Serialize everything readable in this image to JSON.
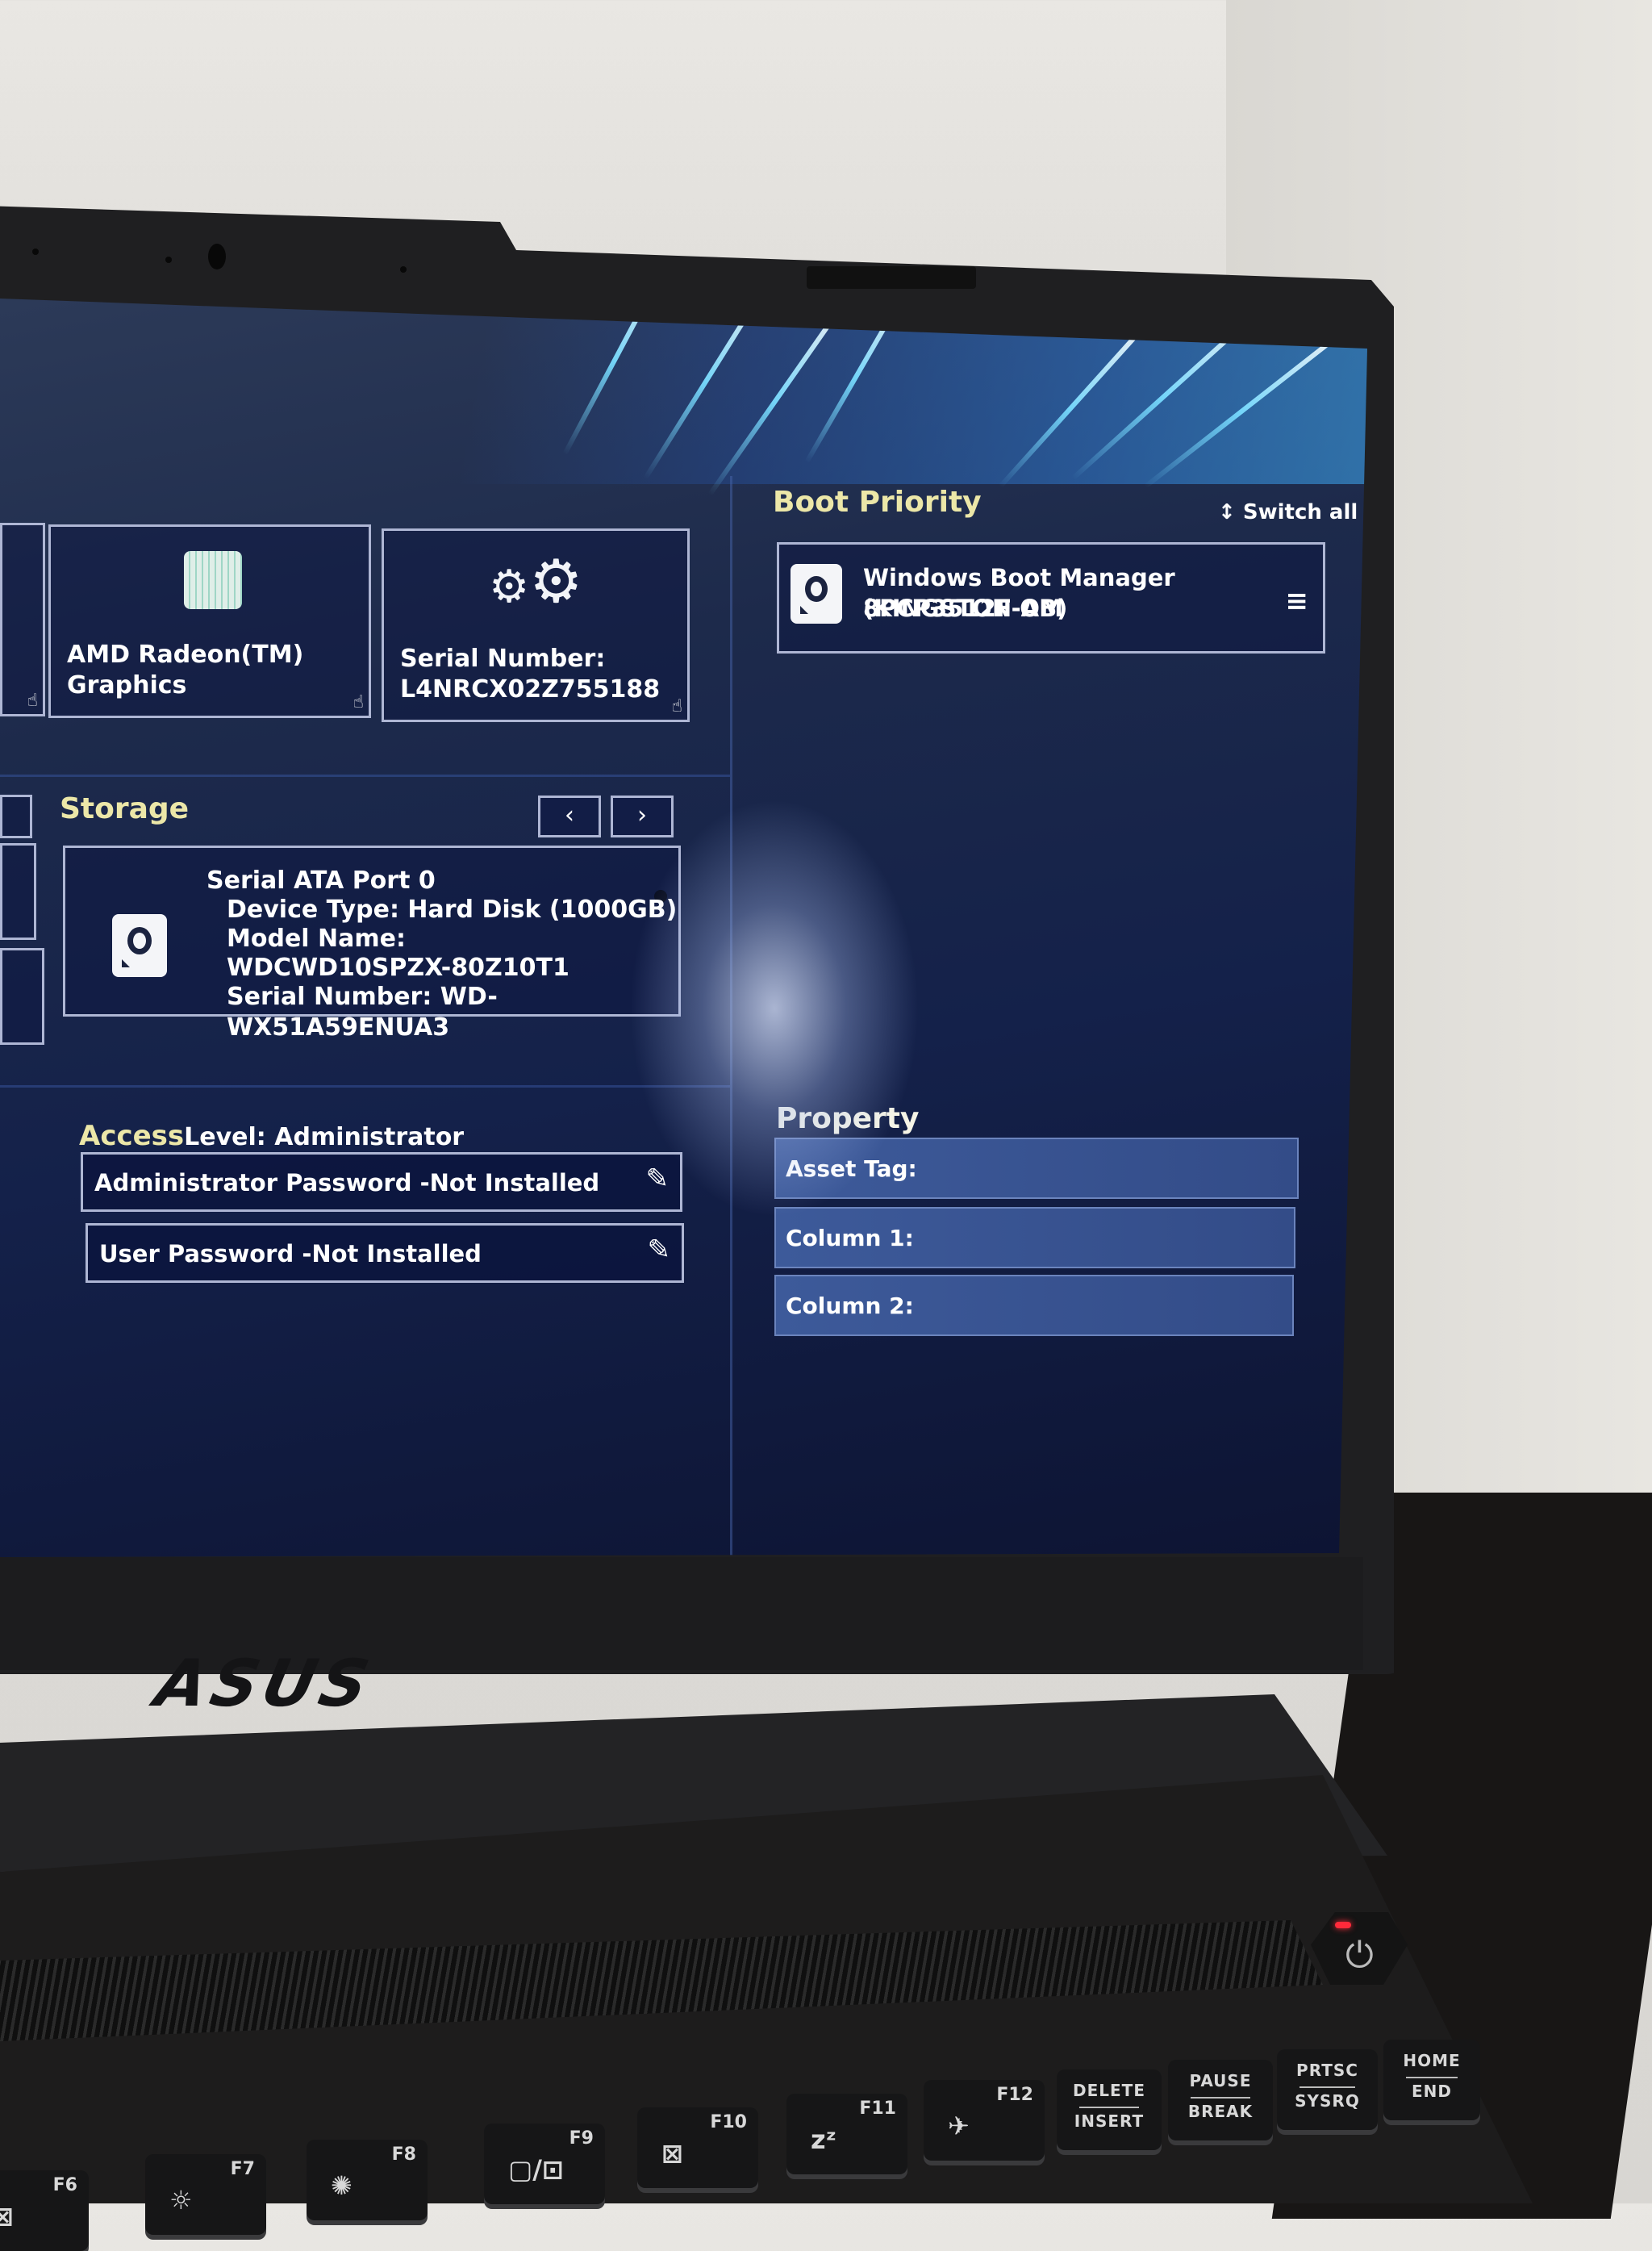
{
  "device": {
    "brand_logo": "ASUS",
    "power_led_color": "#ff2a3a"
  },
  "bios": {
    "accent_color": "#ece7a8",
    "overview_cards": [
      {
        "icon": "gpu-chip-icon",
        "line1": "AMD Radeon(TM)",
        "line2": "Graphics"
      },
      {
        "icon": "gears-icon",
        "line1": "Serial Number:",
        "line2": "L4NRCX02Z755188"
      }
    ],
    "storage": {
      "title": "Storage",
      "prev_label": "‹",
      "next_label": "›",
      "port": "Serial ATA Port 0",
      "device_type": "Device Type: Hard Disk (1000GB)",
      "model_label": "Model Name:",
      "model_value": "WDCWD10SPZX-80Z10T1",
      "serial": "Serial Number: WD-WX51A59ENUA3"
    },
    "access": {
      "title_prefix": "Access",
      "title_suffix": "Level: Administrator",
      "rows": [
        {
          "label": "Administrator Password -Not Installed"
        },
        {
          "label": "User Password -Not Installed"
        }
      ]
    },
    "boot_priority": {
      "title": "Boot Priority",
      "switch_all_label": "Switch all",
      "items": [
        {
          "line1": "Windows Boot Manager (KINGSTON OM",
          "line2": "8PCP3512F-AB)"
        }
      ]
    },
    "property": {
      "title": "Property",
      "rows": [
        {
          "label": "Asset Tag:"
        },
        {
          "label": "Column 1:"
        },
        {
          "label": "Column 2:"
        }
      ]
    }
  },
  "keyboard": {
    "function_keys": [
      {
        "fn": "F6",
        "glyph": "⊠"
      },
      {
        "fn": "F7",
        "glyph": "☼"
      },
      {
        "fn": "F8",
        "glyph": "✺"
      },
      {
        "fn": "F9",
        "glyph": "▢/⊡"
      },
      {
        "fn": "F10",
        "glyph": "⊠"
      },
      {
        "fn": "F11",
        "glyph": "zᶻ"
      },
      {
        "fn": "F12",
        "glyph": "✈"
      }
    ],
    "nav_keys": [
      {
        "top": "DELETE",
        "bottom": "INSERT"
      },
      {
        "top": "PAUSE",
        "bottom": "BREAK"
      },
      {
        "top": "PRTSC",
        "bottom": "SYSRQ"
      },
      {
        "top": "HOME",
        "bottom": "END"
      }
    ],
    "power_icon": "⏻"
  }
}
